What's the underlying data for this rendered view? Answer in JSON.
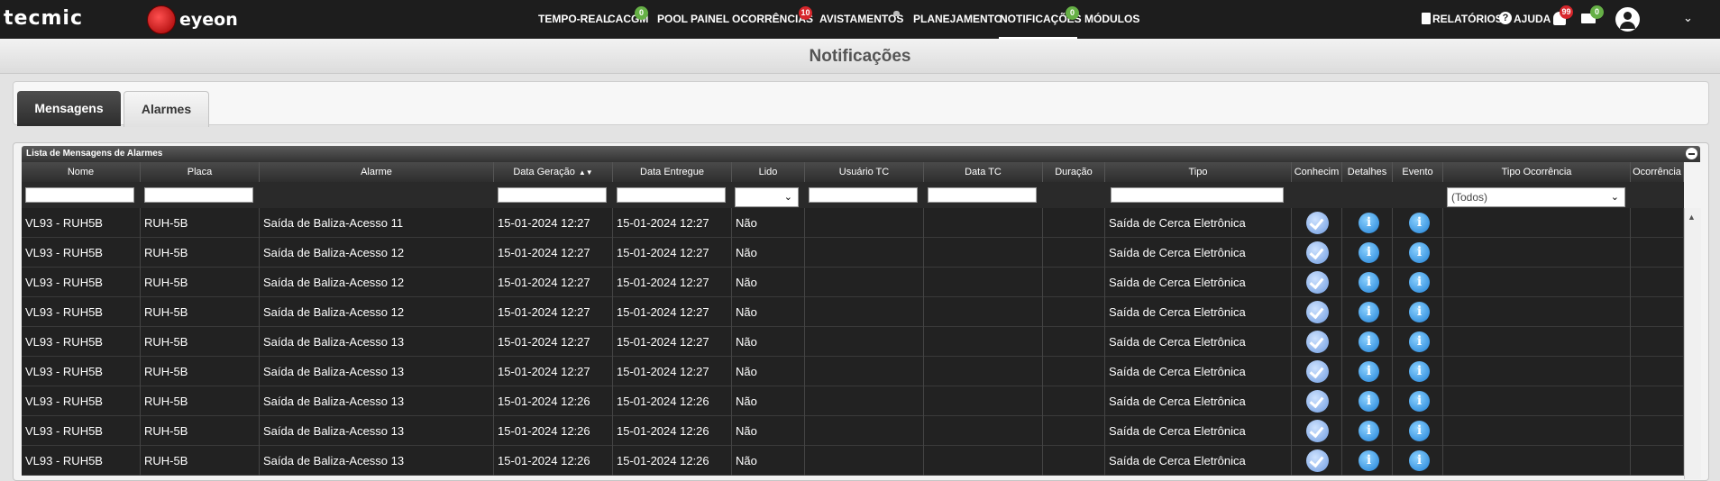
{
  "brand": {
    "logo_primary": "tecmic",
    "logo_secondary": "eyeon"
  },
  "nav": {
    "items": [
      {
        "label": "TEMPO-REAL"
      },
      {
        "label": "CACGM",
        "badge": "0"
      },
      {
        "label": "POOL"
      },
      {
        "label": "PAINEL"
      },
      {
        "label": "OCORRÊNCIAS",
        "badge": "10"
      },
      {
        "label": "AVISTAMENTOS"
      },
      {
        "label": "PLANEJAMENTO"
      },
      {
        "label": "NOTIFICAÇÕES",
        "badge": "0",
        "active": true
      },
      {
        "label": "MÓDULOS"
      }
    ]
  },
  "header_right": {
    "reports_label": "RELATÓRIOS",
    "help_label": "AJUDA",
    "bell_badge": "99",
    "mail_badge": "0"
  },
  "page": {
    "title": "Notificações"
  },
  "tabs": [
    {
      "label": "Mensagens",
      "active": true
    },
    {
      "label": "Alarmes",
      "active": false
    }
  ],
  "grid": {
    "caption": "Lista de Mensagens de Alarmes",
    "columns": [
      "Nome",
      "Placa",
      "Alarme",
      "Data Geração",
      "Data Entregue",
      "Lido",
      "Usuário TC",
      "Data TC",
      "Duração",
      "Tipo",
      "Conhecim",
      "Detalhes",
      "Evento",
      "Tipo Ocorrência",
      "Ocorrência"
    ],
    "filter_tipo_ocorrencia": "(Todos)",
    "rows": [
      [
        "VL93 -  RUH5B",
        "RUH-5B",
        "Saída de Baliza-Acesso 11",
        "15-01-2024 12:27",
        "15-01-2024 12:27",
        "Não",
        "",
        "",
        "",
        "Saída de  Cerca Eletrônica"
      ],
      [
        "VL93 -  RUH5B",
        "RUH-5B",
        "Saída de Baliza-Acesso 12",
        "15-01-2024 12:27",
        "15-01-2024 12:27",
        "Não",
        "",
        "",
        "",
        "Saída de  Cerca Eletrônica"
      ],
      [
        "VL93 -  RUH5B",
        "RUH-5B",
        "Saída de Baliza-Acesso 12",
        "15-01-2024 12:27",
        "15-01-2024 12:27",
        "Não",
        "",
        "",
        "",
        "Saída de  Cerca Eletrônica"
      ],
      [
        "VL93 -  RUH5B",
        "RUH-5B",
        "Saída de Baliza-Acesso 12",
        "15-01-2024 12:27",
        "15-01-2024 12:27",
        "Não",
        "",
        "",
        "",
        "Saída de  Cerca Eletrônica"
      ],
      [
        "VL93 -  RUH5B",
        "RUH-5B",
        "Saída de Baliza-Acesso 13",
        "15-01-2024 12:27",
        "15-01-2024 12:27",
        "Não",
        "",
        "",
        "",
        "Saída de  Cerca Eletrônica"
      ],
      [
        "VL93 -  RUH5B",
        "RUH-5B",
        "Saída de Baliza-Acesso 13",
        "15-01-2024 12:27",
        "15-01-2024 12:27",
        "Não",
        "",
        "",
        "",
        "Saída de  Cerca Eletrônica"
      ],
      [
        "VL93 -  RUH5B",
        "RUH-5B",
        "Saída de Baliza-Acesso 13",
        "15-01-2024 12:26",
        "15-01-2024 12:26",
        "Não",
        "",
        "",
        "",
        "Saída de  Cerca Eletrônica"
      ],
      [
        "VL93 -  RUH5B",
        "RUH-5B",
        "Saída de Baliza-Acesso 13",
        "15-01-2024 12:26",
        "15-01-2024 12:26",
        "Não",
        "",
        "",
        "",
        "Saída de  Cerca Eletrônica"
      ],
      [
        "VL93 -  RUH5B",
        "RUH-5B",
        "Saída de Baliza-Acesso 13",
        "15-01-2024 12:26",
        "15-01-2024 12:26",
        "Não",
        "",
        "",
        "",
        "Saída de  Cerca Eletrônica"
      ]
    ]
  },
  "icons": {
    "conhecimento": "check-icon",
    "detalhes": "info-icon",
    "evento": "info-icon"
  },
  "colors": {
    "topbar": "#1d1d1d",
    "badge_green": "#66b046",
    "badge_red": "#d7262b",
    "row_bg": "#222222"
  }
}
